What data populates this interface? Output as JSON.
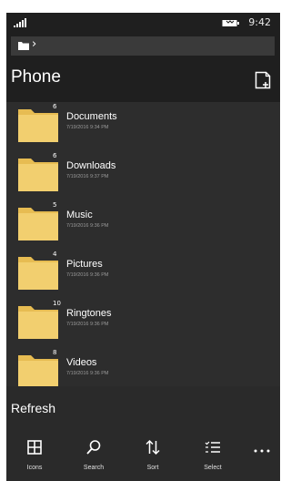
{
  "status_bar": {
    "time": "9:42"
  },
  "header": {
    "title": "Phone"
  },
  "files": [
    {
      "name": "Documents",
      "count": "6",
      "date": "7/19/2016 9:34 PM"
    },
    {
      "name": "Downloads",
      "count": "6",
      "date": "7/19/2016 9:37 PM"
    },
    {
      "name": "Music",
      "count": "5",
      "date": "7/19/2016 9:36 PM"
    },
    {
      "name": "Pictures",
      "count": "4",
      "date": "7/19/2016 9:36 PM"
    },
    {
      "name": "Ringtones",
      "count": "10",
      "date": "7/19/2016 9:36 PM"
    },
    {
      "name": "Videos",
      "count": "8",
      "date": "7/19/2016 9:36 PM"
    }
  ],
  "bottom": {
    "refresh_label": "Refresh",
    "app_bar": [
      {
        "label": "Icons",
        "icon": "grid-icon"
      },
      {
        "label": "Search",
        "icon": "search-icon"
      },
      {
        "label": "Sort",
        "icon": "sort-icon"
      },
      {
        "label": "Select",
        "icon": "select-icon"
      }
    ],
    "more_icon": "more-icon"
  },
  "colors": {
    "background": "#1f1f1f",
    "list_background": "#2d2d2d",
    "path_bar": "#3a3a3a",
    "folder": "#f2cf6f",
    "folder_tab": "#e7bc52"
  }
}
